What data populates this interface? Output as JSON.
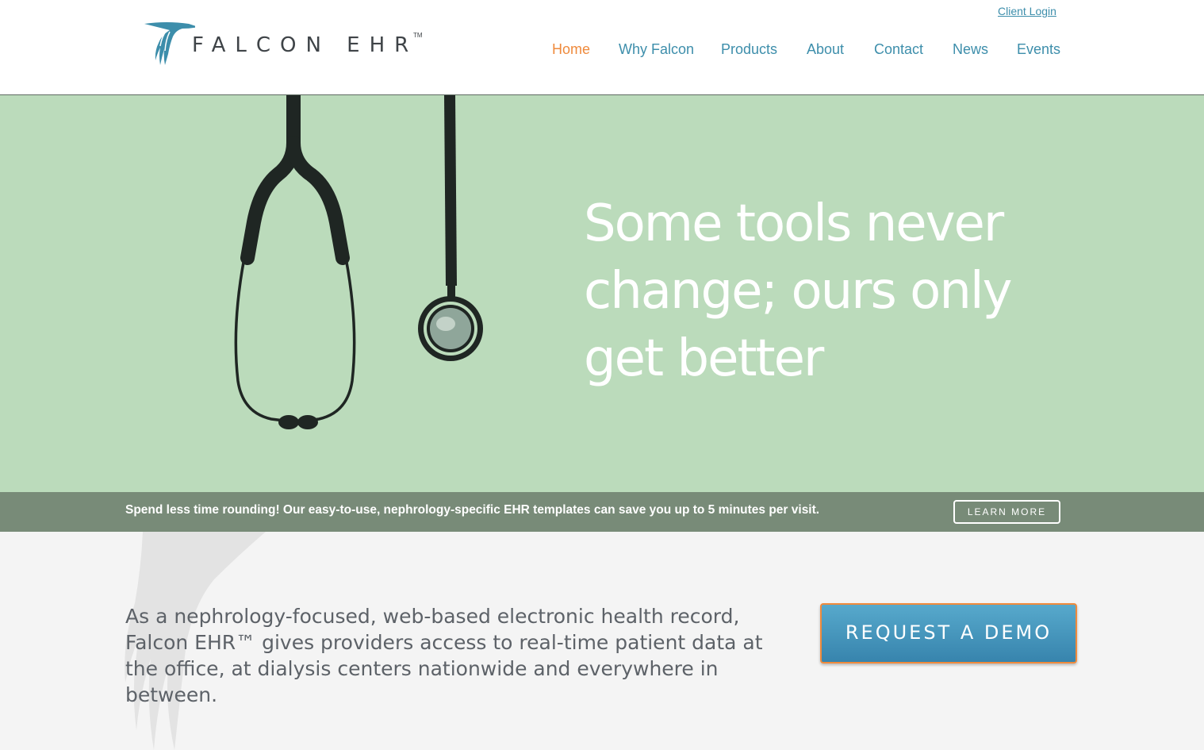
{
  "header": {
    "logo_text": "FALCON EHR",
    "logo_tm": "TM",
    "client_login": "Client Login",
    "nav": [
      {
        "label": "Home",
        "active": true
      },
      {
        "label": "Why Falcon",
        "active": false
      },
      {
        "label": "Products",
        "active": false
      },
      {
        "label": "About",
        "active": false
      },
      {
        "label": "Contact",
        "active": false
      },
      {
        "label": "News",
        "active": false
      },
      {
        "label": "Events",
        "active": false
      }
    ]
  },
  "hero": {
    "headline": "Some tools never change; ours only get better"
  },
  "promo": {
    "text": "Spend less time rounding! Our easy-to-use, nephrology-specific EHR templates can save you up to 5 minutes per visit.",
    "learn_more": "LEARN MORE"
  },
  "intro": {
    "text": "As a nephrology-focused, web-based electronic health record, Falcon EHR™ gives providers access to real-time patient data at the office, at dialysis centers nationwide and everywhere in between.",
    "demo_button": "REQUEST A DEMO"
  },
  "colors": {
    "accent_blue": "#3d8eab",
    "accent_orange": "#ef8a3c",
    "hero_green": "#bbdbbb",
    "promo_green": "#788b78"
  },
  "icons": {
    "logo": "falcon-bird-icon",
    "hero_image": "stethoscope-icon",
    "watermark": "falcon-wing-icon"
  }
}
